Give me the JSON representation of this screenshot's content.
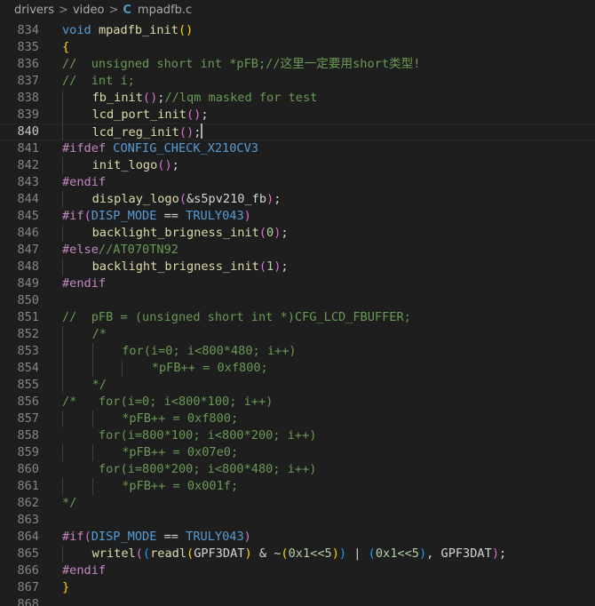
{
  "breadcrumb": {
    "segments": [
      "drivers",
      "video"
    ],
    "file_icon": "C",
    "file": "mpadfb.c",
    "separator": ">"
  },
  "editor": {
    "current_line": 840,
    "lines": [
      {
        "n": "834",
        "indent": 0,
        "t": [
          [
            "void",
            "kw"
          ],
          [
            " ",
            "tx"
          ],
          [
            "mpadfb_init",
            "fn"
          ],
          [
            "()",
            "br1"
          ]
        ]
      },
      {
        "n": "835",
        "indent": 0,
        "t": [
          [
            "{",
            "br1"
          ]
        ]
      },
      {
        "n": "836",
        "indent": 0,
        "t": [
          [
            "//  unsigned short int *pFB;//这里一定要用short类型!",
            "cm"
          ]
        ]
      },
      {
        "n": "837",
        "indent": 0,
        "t": [
          [
            "//  int i;",
            "cm"
          ]
        ]
      },
      {
        "n": "838",
        "indent": 1,
        "t": [
          [
            "fb_init",
            "fn"
          ],
          [
            "()",
            "br2"
          ],
          [
            ";",
            "tx"
          ],
          [
            "//lqm masked for test",
            "cm"
          ]
        ]
      },
      {
        "n": "839",
        "indent": 1,
        "t": [
          [
            "lcd_port_init",
            "fn"
          ],
          [
            "()",
            "br2"
          ],
          [
            ";",
            "tx"
          ]
        ]
      },
      {
        "n": "840",
        "indent": 1,
        "t": [
          [
            "lcd_reg_init",
            "fn"
          ],
          [
            "()",
            "br2"
          ],
          [
            ";",
            "tx"
          ]
        ],
        "caret": true
      },
      {
        "n": "841",
        "indent": 0,
        "t": [
          [
            "#ifdef",
            "pp"
          ],
          [
            " ",
            "tx"
          ],
          [
            "CONFIG_CHECK_X210CV3",
            "mac"
          ]
        ]
      },
      {
        "n": "842",
        "indent": 1,
        "t": [
          [
            "init_logo",
            "fn"
          ],
          [
            "()",
            "br2"
          ],
          [
            ";",
            "tx"
          ]
        ]
      },
      {
        "n": "843",
        "indent": 0,
        "t": [
          [
            "#endif",
            "pp"
          ]
        ]
      },
      {
        "n": "844",
        "indent": 1,
        "t": [
          [
            "display_logo",
            "fn"
          ],
          [
            "(",
            "br2"
          ],
          [
            "&s5pv210_fb",
            "tx"
          ],
          [
            ")",
            "br2"
          ],
          [
            ";",
            "tx"
          ]
        ]
      },
      {
        "n": "845",
        "indent": 0,
        "t": [
          [
            "#if",
            "pp"
          ],
          [
            "(",
            "br2"
          ],
          [
            "DISP_MODE",
            "mac"
          ],
          [
            " == ",
            "tx"
          ],
          [
            "TRULY043",
            "mac"
          ],
          [
            ")",
            "br2"
          ]
        ]
      },
      {
        "n": "846",
        "indent": 1,
        "t": [
          [
            "backlight_brigness_init",
            "fn"
          ],
          [
            "(",
            "br2"
          ],
          [
            "0",
            "num"
          ],
          [
            ")",
            "br2"
          ],
          [
            ";",
            "tx"
          ]
        ]
      },
      {
        "n": "847",
        "indent": 0,
        "t": [
          [
            "#else",
            "pp"
          ],
          [
            "//AT070TN92",
            "cm"
          ]
        ]
      },
      {
        "n": "848",
        "indent": 1,
        "t": [
          [
            "backlight_brigness_init",
            "fn"
          ],
          [
            "(",
            "br2"
          ],
          [
            "1",
            "num"
          ],
          [
            ")",
            "br2"
          ],
          [
            ";",
            "tx"
          ]
        ]
      },
      {
        "n": "849",
        "indent": 0,
        "t": [
          [
            "#endif",
            "pp"
          ]
        ]
      },
      {
        "n": "850",
        "indent": 0,
        "t": []
      },
      {
        "n": "851",
        "indent": 0,
        "t": [
          [
            "//  pFB = (unsigned short int *)CFG_LCD_FBUFFER;",
            "cm"
          ]
        ]
      },
      {
        "n": "852",
        "indent": 1,
        "t": [
          [
            "/*",
            "cm"
          ]
        ]
      },
      {
        "n": "853",
        "indent": 2,
        "t": [
          [
            "for(i=0; i<800*480; i++)",
            "cm"
          ]
        ]
      },
      {
        "n": "854",
        "indent": 3,
        "t": [
          [
            "*pFB++ = 0xf800;",
            "cm"
          ]
        ]
      },
      {
        "n": "855",
        "indent": 1,
        "t": [
          [
            "*/",
            "cm"
          ]
        ]
      },
      {
        "n": "856",
        "indent": 0,
        "t": [
          [
            "/*   for(i=0; i<800*100; i++)",
            "cm"
          ]
        ]
      },
      {
        "n": "857",
        "indent": 2,
        "t": [
          [
            "*pFB++ = 0xf800;",
            "cm"
          ]
        ]
      },
      {
        "n": "858",
        "indent": 0,
        "t": [
          [
            "     for(i=800*100; i<800*200; i++)",
            "cm"
          ]
        ]
      },
      {
        "n": "859",
        "indent": 2,
        "t": [
          [
            "*pFB++ = 0x07e0;",
            "cm"
          ]
        ]
      },
      {
        "n": "860",
        "indent": 0,
        "t": [
          [
            "     for(i=800*200; i<800*480; i++)",
            "cm"
          ]
        ]
      },
      {
        "n": "861",
        "indent": 2,
        "t": [
          [
            "*pFB++ = 0x001f;",
            "cm"
          ]
        ]
      },
      {
        "n": "862",
        "indent": 0,
        "t": [
          [
            "*/",
            "cm"
          ]
        ]
      },
      {
        "n": "863",
        "indent": 0,
        "t": []
      },
      {
        "n": "864",
        "indent": 0,
        "t": [
          [
            "#if",
            "pp"
          ],
          [
            "(",
            "br2"
          ],
          [
            "DISP_MODE",
            "mac"
          ],
          [
            " == ",
            "tx"
          ],
          [
            "TRULY043",
            "mac"
          ],
          [
            ")",
            "br2"
          ]
        ]
      },
      {
        "n": "865",
        "indent": 1,
        "t": [
          [
            "writel",
            "fn"
          ],
          [
            "(",
            "br2"
          ],
          [
            "(",
            "br3"
          ],
          [
            "readl",
            "fn"
          ],
          [
            "(",
            "br1"
          ],
          [
            "GPF3DAT",
            "tx"
          ],
          [
            ")",
            "br1"
          ],
          [
            " & ~",
            "tx"
          ],
          [
            "(",
            "br1"
          ],
          [
            "0x1<<5",
            "num"
          ],
          [
            ")",
            "br1"
          ],
          [
            ")",
            "br3"
          ],
          [
            " | ",
            "tx"
          ],
          [
            "(",
            "br3"
          ],
          [
            "0x1<<5",
            "num"
          ],
          [
            ")",
            "br3"
          ],
          [
            ", GPF3DAT",
            "tx"
          ],
          [
            ")",
            "br2"
          ],
          [
            ";",
            "tx"
          ]
        ]
      },
      {
        "n": "866",
        "indent": 0,
        "t": [
          [
            "#endif",
            "pp"
          ]
        ]
      },
      {
        "n": "867",
        "indent": 0,
        "t": [
          [
            "}",
            "br1"
          ]
        ]
      },
      {
        "n": "868",
        "indent": 0,
        "t": []
      }
    ]
  }
}
